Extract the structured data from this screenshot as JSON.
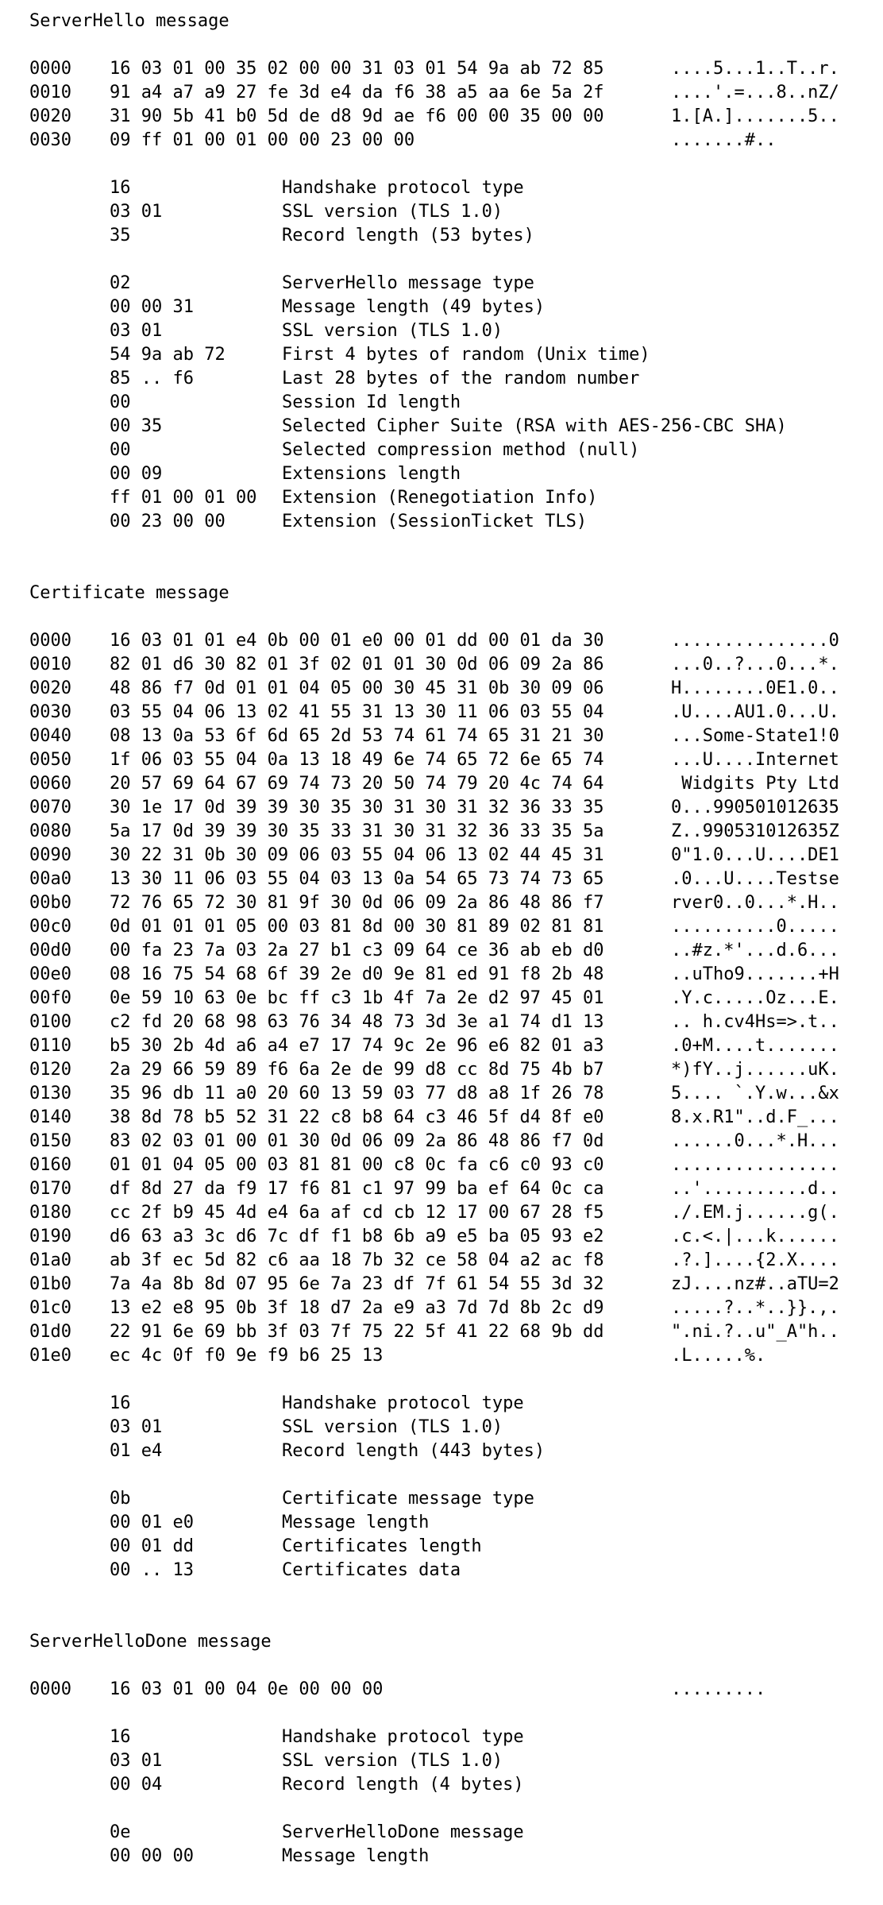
{
  "sections": [
    {
      "title": "ServerHello message",
      "dump": [
        {
          "offset": "0000",
          "hex": "16 03 01 00 35 02 00 00 31 03 01 54 9a ab 72 85",
          "ascii": "....5...1..T..r."
        },
        {
          "offset": "0010",
          "hex": "91 a4 a7 a9 27 fe 3d e4 da f6 38 a5 aa 6e 5a 2f",
          "ascii": "....'.=...8..nZ/"
        },
        {
          "offset": "0020",
          "hex": "31 90 5b 41 b0 5d de d8 9d ae f6 00 00 35 00 00",
          "ascii": "1.[A.].......5.."
        },
        {
          "offset": "0030",
          "hex": "09 ff 01 00 01 00 00 23 00 00",
          "ascii": ".......#.."
        }
      ],
      "groups": [
        [
          {
            "value": "16",
            "desc": "Handshake protocol type"
          },
          {
            "value": "03 01",
            "desc": "SSL version (TLS 1.0)"
          },
          {
            "value": "35",
            "desc": "Record length (53 bytes)"
          }
        ],
        [
          {
            "value": "02",
            "desc": "ServerHello message type"
          },
          {
            "value": "00 00 31",
            "desc": "Message length (49 bytes)"
          },
          {
            "value": "03 01",
            "desc": "SSL version (TLS 1.0)"
          },
          {
            "value": "54 9a ab 72",
            "desc": "First 4 bytes of random (Unix time)"
          },
          {
            "value": "85 .. f6",
            "desc": "Last 28 bytes of the random number"
          },
          {
            "value": "00",
            "desc": "Session Id length"
          },
          {
            "value": "00 35",
            "desc": "Selected Cipher Suite (RSA with AES-256-CBC SHA)"
          },
          {
            "value": "00",
            "desc": "Selected compression method (null)"
          },
          {
            "value": "00 09",
            "desc": "Extensions length"
          },
          {
            "value": "ff 01 00 01 00",
            "desc": "Extension (Renegotiation Info)"
          },
          {
            "value": "00 23 00 00",
            "desc": "Extension (SessionTicket TLS)"
          }
        ]
      ]
    },
    {
      "title": "Certificate message",
      "dump": [
        {
          "offset": "0000",
          "hex": "16 03 01 01 e4 0b 00 01 e0 00 01 dd 00 01 da 30",
          "ascii": "...............0"
        },
        {
          "offset": "0010",
          "hex": "82 01 d6 30 82 01 3f 02 01 01 30 0d 06 09 2a 86",
          "ascii": "...0..?...0...*."
        },
        {
          "offset": "0020",
          "hex": "48 86 f7 0d 01 01 04 05 00 30 45 31 0b 30 09 06",
          "ascii": "H........0E1.0.."
        },
        {
          "offset": "0030",
          "hex": "03 55 04 06 13 02 41 55 31 13 30 11 06 03 55 04",
          "ascii": ".U....AU1.0...U."
        },
        {
          "offset": "0040",
          "hex": "08 13 0a 53 6f 6d 65 2d 53 74 61 74 65 31 21 30",
          "ascii": "...Some-State1!0"
        },
        {
          "offset": "0050",
          "hex": "1f 06 03 55 04 0a 13 18 49 6e 74 65 72 6e 65 74",
          "ascii": "...U....Internet"
        },
        {
          "offset": "0060",
          "hex": "20 57 69 64 67 69 74 73 20 50 74 79 20 4c 74 64",
          "ascii": " Widgits Pty Ltd"
        },
        {
          "offset": "0070",
          "hex": "30 1e 17 0d 39 39 30 35 30 31 30 31 32 36 33 35",
          "ascii": "0...990501012635"
        },
        {
          "offset": "0080",
          "hex": "5a 17 0d 39 39 30 35 33 31 30 31 32 36 33 35 5a",
          "ascii": "Z..990531012635Z"
        },
        {
          "offset": "0090",
          "hex": "30 22 31 0b 30 09 06 03 55 04 06 13 02 44 45 31",
          "ascii": "0\"1.0...U....DE1"
        },
        {
          "offset": "00a0",
          "hex": "13 30 11 06 03 55 04 03 13 0a 54 65 73 74 73 65",
          "ascii": ".0...U....Testse"
        },
        {
          "offset": "00b0",
          "hex": "72 76 65 72 30 81 9f 30 0d 06 09 2a 86 48 86 f7",
          "ascii": "rver0..0...*.H.."
        },
        {
          "offset": "00c0",
          "hex": "0d 01 01 01 05 00 03 81 8d 00 30 81 89 02 81 81",
          "ascii": "..........0....."
        },
        {
          "offset": "00d0",
          "hex": "00 fa 23 7a 03 2a 27 b1 c3 09 64 ce 36 ab eb d0",
          "ascii": "..#z.*'...d.6..."
        },
        {
          "offset": "00e0",
          "hex": "08 16 75 54 68 6f 39 2e d0 9e 81 ed 91 f8 2b 48",
          "ascii": "..uTho9.......+H"
        },
        {
          "offset": "00f0",
          "hex": "0e 59 10 63 0e bc ff c3 1b 4f 7a 2e d2 97 45 01",
          "ascii": ".Y.c.....Oz...E."
        },
        {
          "offset": "0100",
          "hex": "c2 fd 20 68 98 63 76 34 48 73 3d 3e a1 74 d1 13",
          "ascii": ".. h.cv4Hs=>.t.."
        },
        {
          "offset": "0110",
          "hex": "b5 30 2b 4d a6 a4 e7 17 74 9c 2e 96 e6 82 01 a3",
          "ascii": ".0+M....t......."
        },
        {
          "offset": "0120",
          "hex": "2a 29 66 59 89 f6 6a 2e de 99 d8 cc 8d 75 4b b7",
          "ascii": "*)fY..j......uK."
        },
        {
          "offset": "0130",
          "hex": "35 96 db 11 a0 20 60 13 59 03 77 d8 a8 1f 26 78",
          "ascii": "5.... `.Y.w...&x"
        },
        {
          "offset": "0140",
          "hex": "38 8d 78 b5 52 31 22 c8 b8 64 c3 46 5f d4 8f e0",
          "ascii": "8.x.R1\"..d.F_..."
        },
        {
          "offset": "0150",
          "hex": "83 02 03 01 00 01 30 0d 06 09 2a 86 48 86 f7 0d",
          "ascii": "......0...*.H..."
        },
        {
          "offset": "0160",
          "hex": "01 01 04 05 00 03 81 81 00 c8 0c fa c6 c0 93 c0",
          "ascii": "................"
        },
        {
          "offset": "0170",
          "hex": "df 8d 27 da f9 17 f6 81 c1 97 99 ba ef 64 0c ca",
          "ascii": "..'..........d.."
        },
        {
          "offset": "0180",
          "hex": "cc 2f b9 45 4d e4 6a af cd cb 12 17 00 67 28 f5",
          "ascii": "./.EM.j......g(."
        },
        {
          "offset": "0190",
          "hex": "d6 63 a3 3c d6 7c df f1 b8 6b a9 e5 ba 05 93 e2",
          "ascii": ".c.<.|...k......"
        },
        {
          "offset": "01a0",
          "hex": "ab 3f ec 5d 82 c6 aa 18 7b 32 ce 58 04 a2 ac f8",
          "ascii": ".?.]....{2.X...."
        },
        {
          "offset": "01b0",
          "hex": "7a 4a 8b 8d 07 95 6e 7a 23 df 7f 61 54 55 3d 32",
          "ascii": "zJ....nz#..aTU=2"
        },
        {
          "offset": "01c0",
          "hex": "13 e2 e8 95 0b 3f 18 d7 2a e9 a3 7d 7d 8b 2c d9",
          "ascii": ".....?..*..}}.,."
        },
        {
          "offset": "01d0",
          "hex": "22 91 6e 69 bb 3f 03 7f 75 22 5f 41 22 68 9b dd",
          "ascii": "\".ni.?..u\"_A\"h.."
        },
        {
          "offset": "01e0",
          "hex": "ec 4c 0f f0 9e f9 b6 25 13",
          "ascii": ".L.....%."
        }
      ],
      "groups": [
        [
          {
            "value": "16",
            "desc": "Handshake protocol type"
          },
          {
            "value": "03 01",
            "desc": "SSL version (TLS 1.0)"
          },
          {
            "value": "01 e4",
            "desc": "Record length (443 bytes)"
          }
        ],
        [
          {
            "value": "0b",
            "desc": "Certificate message type"
          },
          {
            "value": "00 01 e0",
            "desc": "Message length"
          },
          {
            "value": "00 01 dd",
            "desc": "Certificates length"
          },
          {
            "value": "00 .. 13",
            "desc": "Certificates data"
          }
        ]
      ]
    },
    {
      "title": "ServerHelloDone message",
      "dump": [
        {
          "offset": "0000",
          "hex": "16 03 01 00 04 0e 00 00 00",
          "ascii": "........."
        }
      ],
      "groups": [
        [
          {
            "value": "16",
            "desc": "Handshake protocol type"
          },
          {
            "value": "03 01",
            "desc": "SSL version (TLS 1.0)"
          },
          {
            "value": "00 04",
            "desc": "Record length (4 bytes)"
          }
        ],
        [
          {
            "value": "0e",
            "desc": "ServerHelloDone message"
          },
          {
            "value": "00 00 00",
            "desc": "Message length"
          }
        ]
      ]
    }
  ]
}
